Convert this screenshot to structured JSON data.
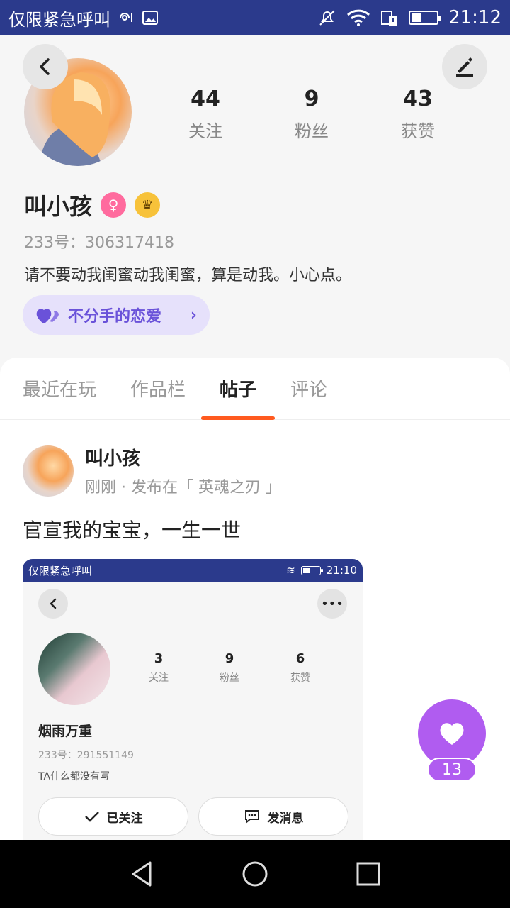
{
  "status_bar": {
    "carrier": "仅限紧急呼叫",
    "time": "21:12",
    "battery_fraction": 0.35
  },
  "profile": {
    "stats": [
      {
        "value": "44",
        "label": "关注"
      },
      {
        "value": "9",
        "label": "粉丝"
      },
      {
        "value": "43",
        "label": "获赞"
      }
    ],
    "name": "叫小孩",
    "uid": "233号：306317418",
    "bio": "请不要动我闺蜜动我闺蜜，算是动我。小心点。",
    "relationship_label": "不分手的恋爱"
  },
  "tabs": [
    {
      "label": "最近在玩",
      "active": false
    },
    {
      "label": "作品栏",
      "active": false
    },
    {
      "label": "帖子",
      "active": true
    },
    {
      "label": "评论",
      "active": false
    }
  ],
  "post": {
    "author": "叫小孩",
    "meta": "刚刚 · 发布在「 英魂之刃 」",
    "title": "官宣我的宝宝，一生一世",
    "embedded": {
      "carrier": "仅限紧急呼叫",
      "time": "21:10",
      "stats": [
        {
          "value": "3",
          "label": "关注"
        },
        {
          "value": "9",
          "label": "粉丝"
        },
        {
          "value": "6",
          "label": "获赞"
        }
      ],
      "name": "烟雨万重",
      "uid": "233号：291551149",
      "bio": "TA什么都没有写",
      "followed_label": "已关注",
      "message_label": "发消息"
    },
    "like_count": "13"
  },
  "colors": {
    "status_bar_bg": "#2b3a8c",
    "tab_indicator": "#ff5a1f",
    "love_accent": "#6a52d9",
    "like_bg": "#b05cf0"
  },
  "icons": [
    "back-icon",
    "edit-icon",
    "female-icon",
    "crown-icon",
    "heart-icon",
    "chevron-right-icon",
    "more-icon",
    "check-icon",
    "message-icon",
    "nav-back-icon",
    "nav-home-icon",
    "nav-recents-icon"
  ]
}
